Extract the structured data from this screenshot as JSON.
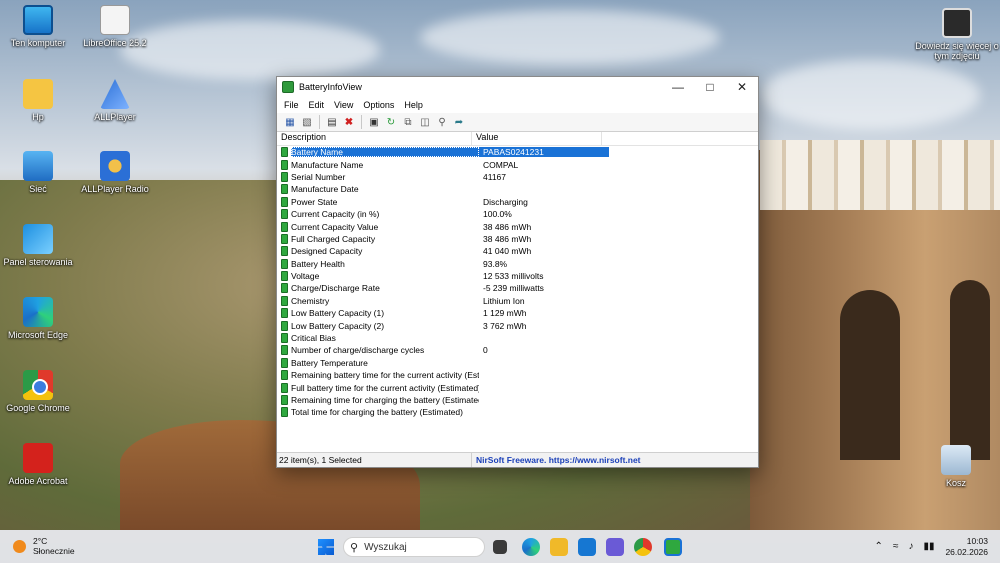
{
  "desktop": {
    "icons": [
      {
        "label": "Ten komputer"
      },
      {
        "label": "LibreOffice 25.2"
      },
      {
        "label": "Hp"
      },
      {
        "label": "ALLPlayer"
      },
      {
        "label": "Sieć"
      },
      {
        "label": "ALLPlayer Radio"
      },
      {
        "label": "Panel sterowania"
      },
      {
        "label": "Microsoft Edge"
      },
      {
        "label": "Google Chrome"
      },
      {
        "label": "Adobe Acrobat"
      },
      {
        "label": "Kosz"
      }
    ],
    "promo": "Dowiedz się więcej o tym zdjęciu"
  },
  "window": {
    "title": "BatteryInfoView",
    "menu": [
      "File",
      "Edit",
      "View",
      "Options",
      "Help"
    ],
    "columns": {
      "description": "Description",
      "value": "Value"
    },
    "rows": [
      {
        "d": "Battery Name",
        "v": "PABAS0241231"
      },
      {
        "d": "Manufacture Name",
        "v": "COMPAL"
      },
      {
        "d": "Serial Number",
        "v": "41167"
      },
      {
        "d": "Manufacture Date",
        "v": ""
      },
      {
        "d": "Power State",
        "v": "Discharging"
      },
      {
        "d": "Current Capacity (in %)",
        "v": "100.0%"
      },
      {
        "d": "Current Capacity Value",
        "v": "38 486 mWh"
      },
      {
        "d": "Full Charged Capacity",
        "v": "38 486 mWh"
      },
      {
        "d": "Designed Capacity",
        "v": "41 040 mWh"
      },
      {
        "d": "Battery Health",
        "v": "93.8%"
      },
      {
        "d": "Voltage",
        "v": "12 533 millivolts"
      },
      {
        "d": "Charge/Discharge Rate",
        "v": "-5 239 milliwatts"
      },
      {
        "d": "Chemistry",
        "v": "Lithium Ion"
      },
      {
        "d": "Low Battery Capacity (1)",
        "v": "1 129 mWh"
      },
      {
        "d": "Low Battery Capacity (2)",
        "v": "3 762 mWh"
      },
      {
        "d": "Critical Bias",
        "v": ""
      },
      {
        "d": "Number of charge/discharge cycles",
        "v": "0"
      },
      {
        "d": "Battery Temperature",
        "v": ""
      },
      {
        "d": "Remaining battery time for the current activity (Est...",
        "v": ""
      },
      {
        "d": "Full battery time for the current activity (Estimated)",
        "v": ""
      },
      {
        "d": "Remaining time for charging the battery (Estimated)",
        "v": ""
      },
      {
        "d": "Total  time for charging the battery (Estimated)",
        "v": ""
      }
    ],
    "status_left": "22 item(s), 1 Selected",
    "status_right": "NirSoft Freeware. https://www.nirsoft.net"
  },
  "taskbar": {
    "weather_temp": "2°C",
    "weather_desc": "Słonecznie",
    "search_placeholder": "Wyszukaj",
    "time": "10:03",
    "date": "26.02.2026"
  }
}
